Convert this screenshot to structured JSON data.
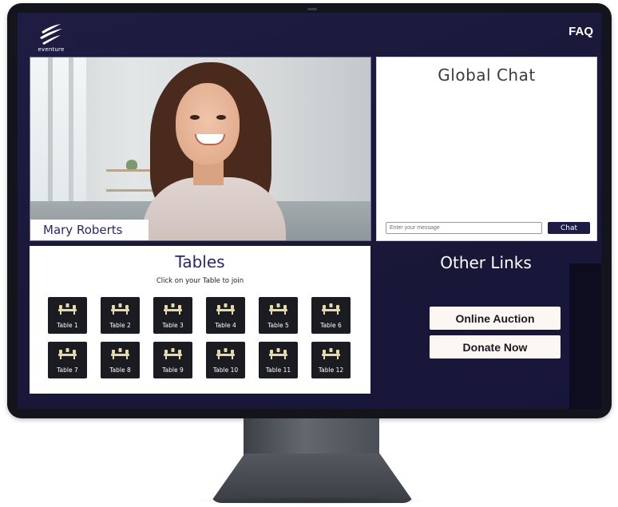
{
  "brand": {
    "name": "eventure"
  },
  "nav": {
    "faq_label": "FAQ"
  },
  "video": {
    "participant_name": "Mary Roberts"
  },
  "chat": {
    "title": "Global Chat",
    "input_placeholder": "Enter your message",
    "send_label": "Chat"
  },
  "tables": {
    "title": "Tables",
    "subtitle": "Click on your Table to join",
    "items": [
      {
        "label": "Table 1"
      },
      {
        "label": "Table 2"
      },
      {
        "label": "Table 3"
      },
      {
        "label": "Table 4"
      },
      {
        "label": "Table 5"
      },
      {
        "label": "Table 6"
      },
      {
        "label": "Table 7"
      },
      {
        "label": "Table 8"
      },
      {
        "label": "Table 9"
      },
      {
        "label": "Table 10"
      },
      {
        "label": "Table 11"
      },
      {
        "label": "Table 12"
      }
    ],
    "icon": "dining-table-icon"
  },
  "other_links": {
    "title": "Other Links",
    "buttons": [
      {
        "label": "Online Auction"
      },
      {
        "label": "Donate Now"
      }
    ]
  },
  "colors": {
    "screen_bg": "#1e1c42",
    "accent_text": "#2b2766",
    "tile_bg": "#1a1c22",
    "tile_icon": "#e7d9a8",
    "button_bg": "#fcf7f2"
  }
}
